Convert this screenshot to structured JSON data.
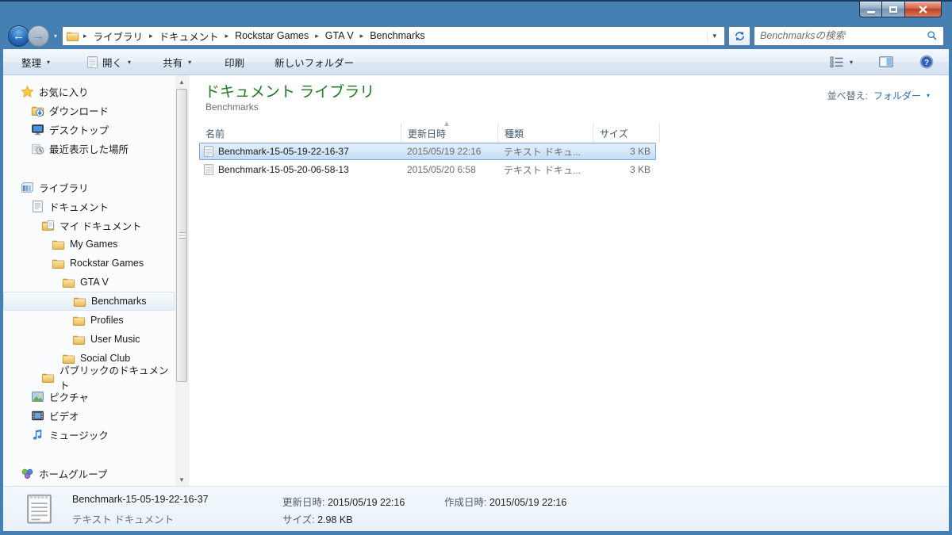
{
  "nav": {
    "breadcrumb": [
      "ライブラリ",
      "ドキュメント",
      "Rockstar Games",
      "GTA V",
      "Benchmarks"
    ],
    "search_placeholder": "Benchmarksの検索"
  },
  "toolbar": {
    "organize": "整理",
    "open": "開く",
    "share": "共有",
    "print": "印刷",
    "new_folder": "新しいフォルダー"
  },
  "sidebar": {
    "items": [
      {
        "label": "お気に入り"
      },
      {
        "label": "ダウンロード"
      },
      {
        "label": "デスクトップ"
      },
      {
        "label": "最近表示した場所"
      },
      {
        "label": "ライブラリ"
      },
      {
        "label": "ドキュメント"
      },
      {
        "label": "マイ ドキュメント"
      },
      {
        "label": "My Games"
      },
      {
        "label": "Rockstar Games"
      },
      {
        "label": "GTA V"
      },
      {
        "label": "Benchmarks"
      },
      {
        "label": "Profiles"
      },
      {
        "label": "User Music"
      },
      {
        "label": "Social Club"
      },
      {
        "label": "パブリックのドキュメント"
      },
      {
        "label": "ピクチャ"
      },
      {
        "label": "ビデオ"
      },
      {
        "label": "ミュージック"
      },
      {
        "label": "ホームグループ"
      }
    ]
  },
  "content": {
    "library_title": "ドキュメント ライブラリ",
    "location": "Benchmarks",
    "arrange_label": "並べ替え:",
    "arrange_value": "フォルダー",
    "columns": [
      "名前",
      "更新日時",
      "種類",
      "サイズ"
    ],
    "files": [
      {
        "name": "Benchmark-15-05-19-22-16-37",
        "modified": "2015/05/19 22:16",
        "type": "テキスト ドキュ...",
        "size": "3 KB"
      },
      {
        "name": "Benchmark-15-05-20-06-58-13",
        "modified": "2015/05/20 6:58",
        "type": "テキスト ドキュ...",
        "size": "3 KB"
      }
    ]
  },
  "details": {
    "name": "Benchmark-15-05-19-22-16-37",
    "type": "テキスト ドキュメント",
    "modified_label": "更新日時:",
    "modified_value": "2015/05/19 22:16",
    "size_label": "サイズ:",
    "size_value": "2.98 KB",
    "created_label": "作成日時:",
    "created_value": "2015/05/19 22:16"
  },
  "icons": {
    "caret_down": "▾",
    "breadcrumb_sep": "▸",
    "sort_asc": "▲",
    "scroll_up": "▲",
    "scroll_down": "▼",
    "back_arrow": "←",
    "forward_arrow": "→"
  },
  "colors": {
    "titlebar_blue": "#4680B2",
    "library_title_green": "#217A21",
    "link_blue": "#2B6FC4",
    "selection_border": "#7DA2CE",
    "folder_yellow": "#EFC75E",
    "close_red": "#C04A33"
  }
}
